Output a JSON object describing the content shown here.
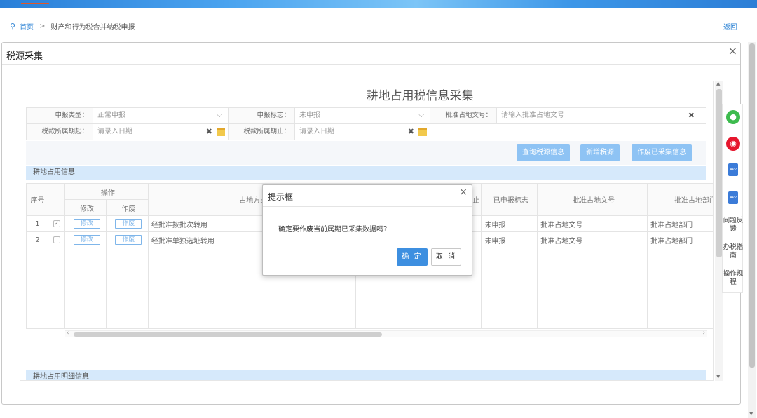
{
  "colors": {
    "accent": "#2b82d4",
    "button_primary": "#8ec3f4",
    "section_header_bg": "#d6e9fb",
    "dialog_ok": "#3d8fe0"
  },
  "breadcrumb": {
    "icon": "location-pin-icon",
    "home": "首页",
    "separator": ">",
    "current": "财产和行为税合并纳税申报"
  },
  "back_link": "返回",
  "window": {
    "title": "税源采集",
    "close_icon": "close-icon"
  },
  "form": {
    "title": "耕地占用税信息采集",
    "row1": {
      "declare_type_label": "申报类型：",
      "declare_type_value": "正常申报",
      "declare_flag_label": "申报标志：",
      "declare_flag_value": "未申报",
      "approval_doc_label": "批准占地文号：",
      "approval_doc_placeholder": "请输入批准占地文号"
    },
    "row2": {
      "period_start_label": "税款所属期起：",
      "period_start_placeholder": "请录入日期",
      "period_end_label": "税款所属期止：",
      "period_end_placeholder": "请录入日期"
    }
  },
  "buttons": {
    "query": "查询税源信息",
    "add": "新增税源",
    "void_collected": "作废已采集信息"
  },
  "section1": "耕地占用信息",
  "section2": "耕地占用明细信息",
  "table": {
    "headers": {
      "index": "序号",
      "ops": "操作",
      "edit": "修改",
      "void": "作废",
      "occupy_method": "占地方式",
      "partial_end": "止",
      "declared_flag": "已申报标志",
      "approval_doc": "批准占地文号",
      "approval_dept": "批准占地部门"
    },
    "rows": [
      {
        "index": "1",
        "checked": "✓",
        "edit": "修改",
        "void": "作废",
        "method": "经批准按批次转用",
        "flag": "未申报",
        "doc": "批准占地文号",
        "dept": "批准占地部门"
      },
      {
        "index": "2",
        "checked": "",
        "edit": "修改",
        "void": "作废",
        "method": "经批准单独选址转用",
        "flag": "未申报",
        "doc": "批准占地文号",
        "dept": "批准占地部门"
      }
    ]
  },
  "side_panel": {
    "wechat_icon": "wechat-icon",
    "weibo_icon": "weibo-icon",
    "app_label": "APP",
    "feedback": "问题反馈",
    "guide": "办税指南",
    "procedure": "操作规程"
  },
  "dialog": {
    "title": "提示框",
    "message": "确定要作废当前属期已采集数据吗？",
    "ok": "确 定",
    "cancel": "取 消"
  }
}
